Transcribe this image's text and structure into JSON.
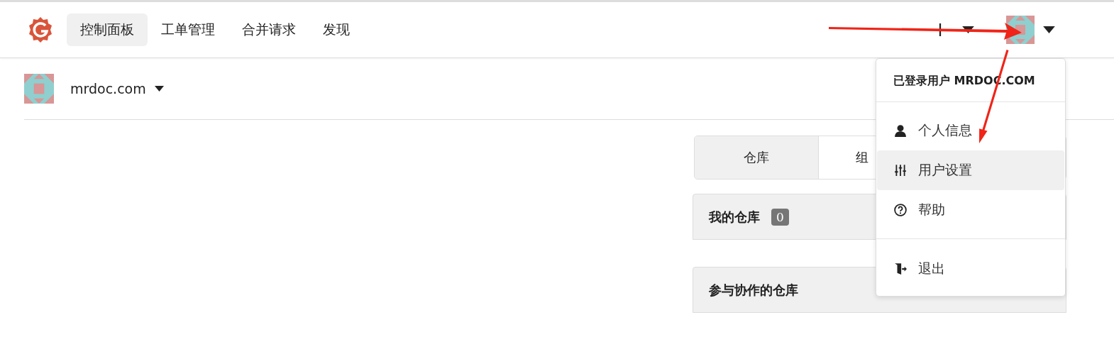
{
  "nav": {
    "items": [
      {
        "label": "控制面板",
        "selected": true
      },
      {
        "label": "工单管理",
        "selected": false
      },
      {
        "label": "合并请求",
        "selected": false
      },
      {
        "label": "发现",
        "selected": false
      }
    ]
  },
  "context": {
    "name": "mrdoc.com"
  },
  "tabs": [
    {
      "label": "仓库",
      "selected": true
    },
    {
      "label": "组",
      "selected": false
    }
  ],
  "panels": [
    {
      "title": "我的仓库",
      "count": "0"
    },
    {
      "title": "参与协作的仓库"
    }
  ],
  "user_menu": {
    "header": "已登录用户 MRDOC.COM",
    "groups": [
      [
        {
          "label": "个人信息",
          "kind": "profile",
          "highlighted": false
        },
        {
          "label": "用户设置",
          "kind": "settings",
          "highlighted": true
        },
        {
          "label": "帮助",
          "kind": "help",
          "highlighted": false
        }
      ],
      [
        {
          "label": "退出",
          "kind": "logout",
          "highlighted": false
        }
      ]
    ]
  }
}
